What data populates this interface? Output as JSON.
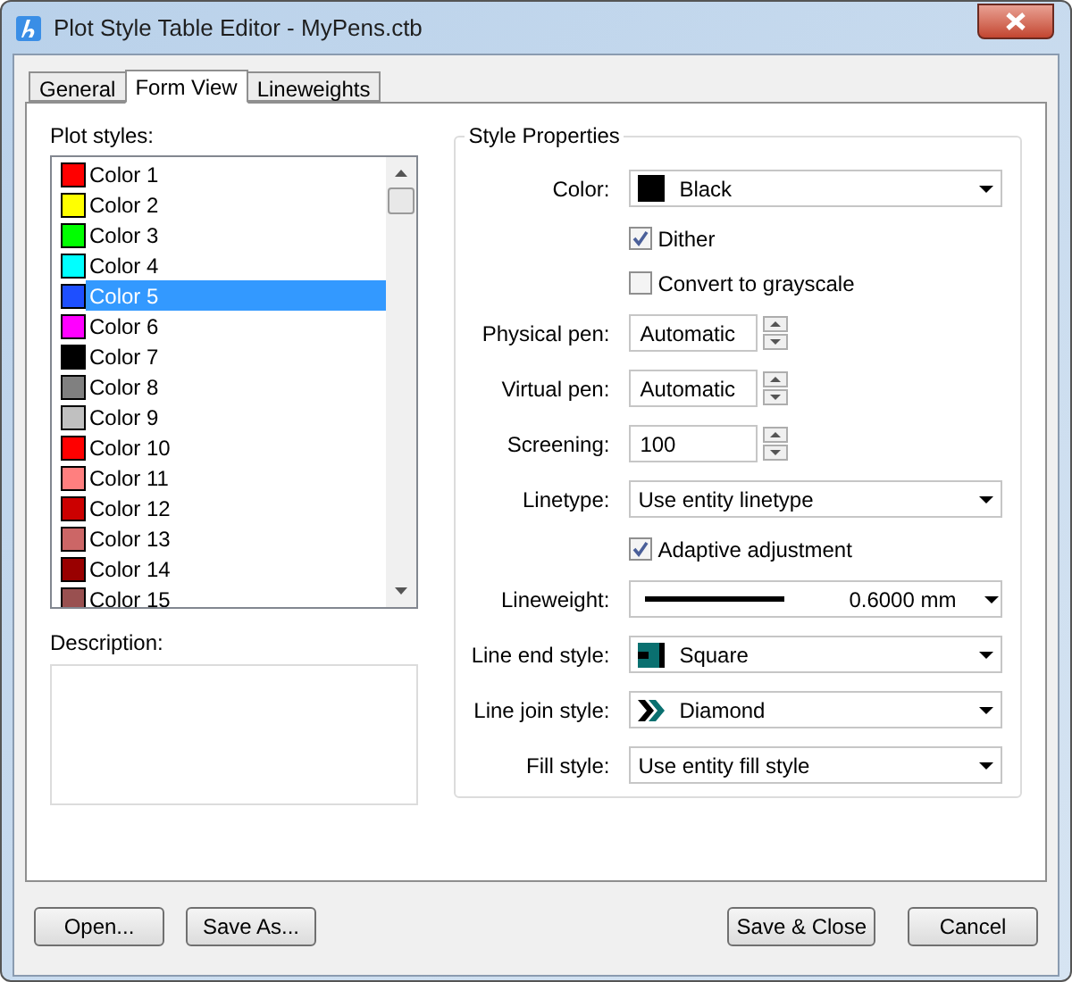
{
  "window": {
    "title": "Plot Style Table Editor - MyPens.ctb"
  },
  "tabs": [
    {
      "label": "General",
      "selected": false
    },
    {
      "label": "Form View",
      "selected": true
    },
    {
      "label": "Lineweights",
      "selected": false
    }
  ],
  "plot_styles": {
    "label": "Plot styles:",
    "items": [
      {
        "name": "Color 1",
        "color": "#ff0000",
        "selected": false
      },
      {
        "name": "Color 2",
        "color": "#ffff00",
        "selected": false
      },
      {
        "name": "Color 3",
        "color": "#00ff00",
        "selected": false
      },
      {
        "name": "Color 4",
        "color": "#00ffff",
        "selected": false
      },
      {
        "name": "Color 5",
        "color": "#1e4fff",
        "selected": true
      },
      {
        "name": "Color 6",
        "color": "#ff00ff",
        "selected": false
      },
      {
        "name": "Color 7",
        "color": "#000000",
        "selected": false
      },
      {
        "name": "Color 8",
        "color": "#808080",
        "selected": false
      },
      {
        "name": "Color 9",
        "color": "#c0c0c0",
        "selected": false
      },
      {
        "name": "Color 10",
        "color": "#ff0000",
        "selected": false
      },
      {
        "name": "Color 11",
        "color": "#ff7f7f",
        "selected": false
      },
      {
        "name": "Color 12",
        "color": "#cc0000",
        "selected": false
      },
      {
        "name": "Color 13",
        "color": "#cc6666",
        "selected": false
      },
      {
        "name": "Color 14",
        "color": "#990000",
        "selected": false
      },
      {
        "name": "Color 15",
        "color": "#995050",
        "selected": false
      }
    ]
  },
  "description": {
    "label": "Description:"
  },
  "style_properties": {
    "title": "Style Properties",
    "rows": [
      {
        "kind": "color-dropdown",
        "label": "Color:",
        "value": "Black",
        "color": "#000000"
      },
      {
        "kind": "checkbox",
        "label": "Dither",
        "checked": true
      },
      {
        "kind": "checkbox",
        "label": "Convert to grayscale",
        "checked": false
      },
      {
        "kind": "spin",
        "label": "Physical pen:",
        "value": "Automatic"
      },
      {
        "kind": "spin",
        "label": "Virtual pen:",
        "value": "Automatic"
      },
      {
        "kind": "spin",
        "label": "Screening:",
        "value": "100"
      },
      {
        "kind": "dropdown",
        "label": "Linetype:",
        "value": "Use entity linetype"
      },
      {
        "kind": "checkbox",
        "label": "Adaptive adjustment",
        "checked": true
      },
      {
        "kind": "lineweight-dropdown",
        "label": "Lineweight:",
        "value": "0.6000 mm"
      },
      {
        "kind": "end-dropdown",
        "label": "Line end style:",
        "value": "Square"
      },
      {
        "kind": "join-dropdown",
        "label": "Line join style:",
        "value": "Diamond"
      },
      {
        "kind": "dropdown",
        "label": "Fill style:",
        "value": "Use entity fill style"
      }
    ]
  },
  "buttons": {
    "left": [
      "Open...",
      "Save As..."
    ],
    "right": [
      "Save & Close",
      "Cancel"
    ]
  }
}
